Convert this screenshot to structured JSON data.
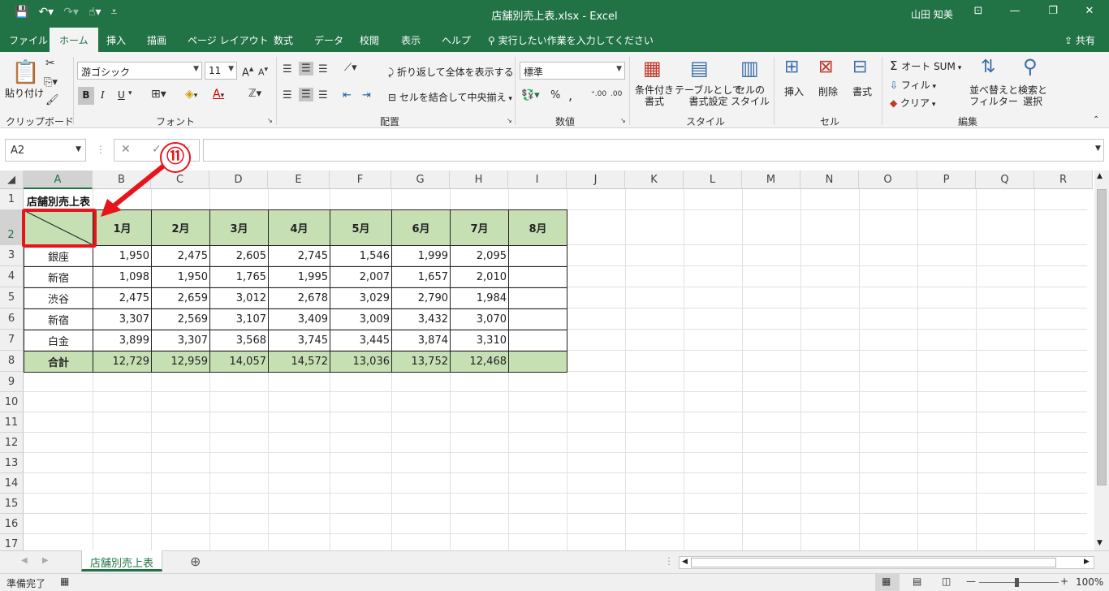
{
  "window": {
    "title": "店舗別売上表.xlsx  -  Excel",
    "user": "山田 知美"
  },
  "menu": {
    "tabs": [
      "ファイル",
      "ホーム",
      "挿入",
      "描画",
      "ページ レイアウト",
      "数式",
      "データ",
      "校閲",
      "表示",
      "ヘルプ"
    ],
    "active": "ホーム",
    "tell_me": "実行したい作業を入力してください",
    "share": "共有"
  },
  "ribbon": {
    "clipboard": {
      "label": "クリップボード",
      "paste": "貼り付け"
    },
    "font": {
      "label": "フォント",
      "name": "游ゴシック",
      "size": "11",
      "bold": "B",
      "italic": "I",
      "underline": "U"
    },
    "alignment": {
      "label": "配置",
      "wrap": "折り返して全体を表示する",
      "merge": "セルを結合して中央揃え"
    },
    "number": {
      "label": "数値",
      "format": "標準"
    },
    "styles": {
      "label": "スタイル",
      "conditional": "条件付き\n書式",
      "table": "テーブルとして\n書式設定",
      "cell_styles": "セルの\nスタイル"
    },
    "cells": {
      "label": "セル",
      "insert": "挿入",
      "delete": "削除",
      "format": "書式"
    },
    "editing": {
      "label": "編集",
      "autosum": "オート SUM",
      "fill": "フィル",
      "clear": "クリア",
      "sort": "並べ替えと\nフィルター",
      "find": "検索と\n選択"
    }
  },
  "formula_bar": {
    "name_box": "A2",
    "formula": ""
  },
  "columns": [
    "A",
    "B",
    "C",
    "D",
    "E",
    "F",
    "G",
    "H",
    "I",
    "J",
    "K",
    "L",
    "M",
    "N",
    "O",
    "P",
    "Q",
    "R"
  ],
  "rows": [
    "1",
    "2",
    "3",
    "4",
    "5",
    "6",
    "7",
    "8",
    "9",
    "10",
    "11",
    "12",
    "13",
    "14",
    "15",
    "16",
    "17"
  ],
  "sheet": {
    "title_cell": "店舗別売上表",
    "months": [
      "1月",
      "2月",
      "3月",
      "4月",
      "5月",
      "6月",
      "7月",
      "8月"
    ],
    "stores": [
      {
        "name": "銀座",
        "values": [
          "1,950",
          "2,475",
          "2,605",
          "2,745",
          "1,546",
          "1,999",
          "2,095",
          ""
        ]
      },
      {
        "name": "新宿",
        "values": [
          "1,098",
          "1,950",
          "1,765",
          "1,995",
          "2,007",
          "1,657",
          "2,010",
          ""
        ]
      },
      {
        "name": "渋谷",
        "values": [
          "2,475",
          "2,659",
          "3,012",
          "2,678",
          "3,029",
          "2,790",
          "1,984",
          ""
        ]
      },
      {
        "name": "新宿",
        "values": [
          "3,307",
          "2,569",
          "3,107",
          "3,409",
          "3,009",
          "3,432",
          "3,070",
          ""
        ]
      },
      {
        "name": "白金",
        "values": [
          "3,899",
          "3,307",
          "3,568",
          "3,745",
          "3,445",
          "3,874",
          "3,310",
          ""
        ]
      }
    ],
    "total": {
      "name": "合計",
      "values": [
        "12,729",
        "12,959",
        "14,057",
        "14,572",
        "13,036",
        "13,752",
        "12,468",
        ""
      ]
    }
  },
  "sheet_tab": "店舗別売上表",
  "status": {
    "ready": "準備完了",
    "zoom": "100%"
  },
  "annotation": {
    "number": "⑪"
  }
}
